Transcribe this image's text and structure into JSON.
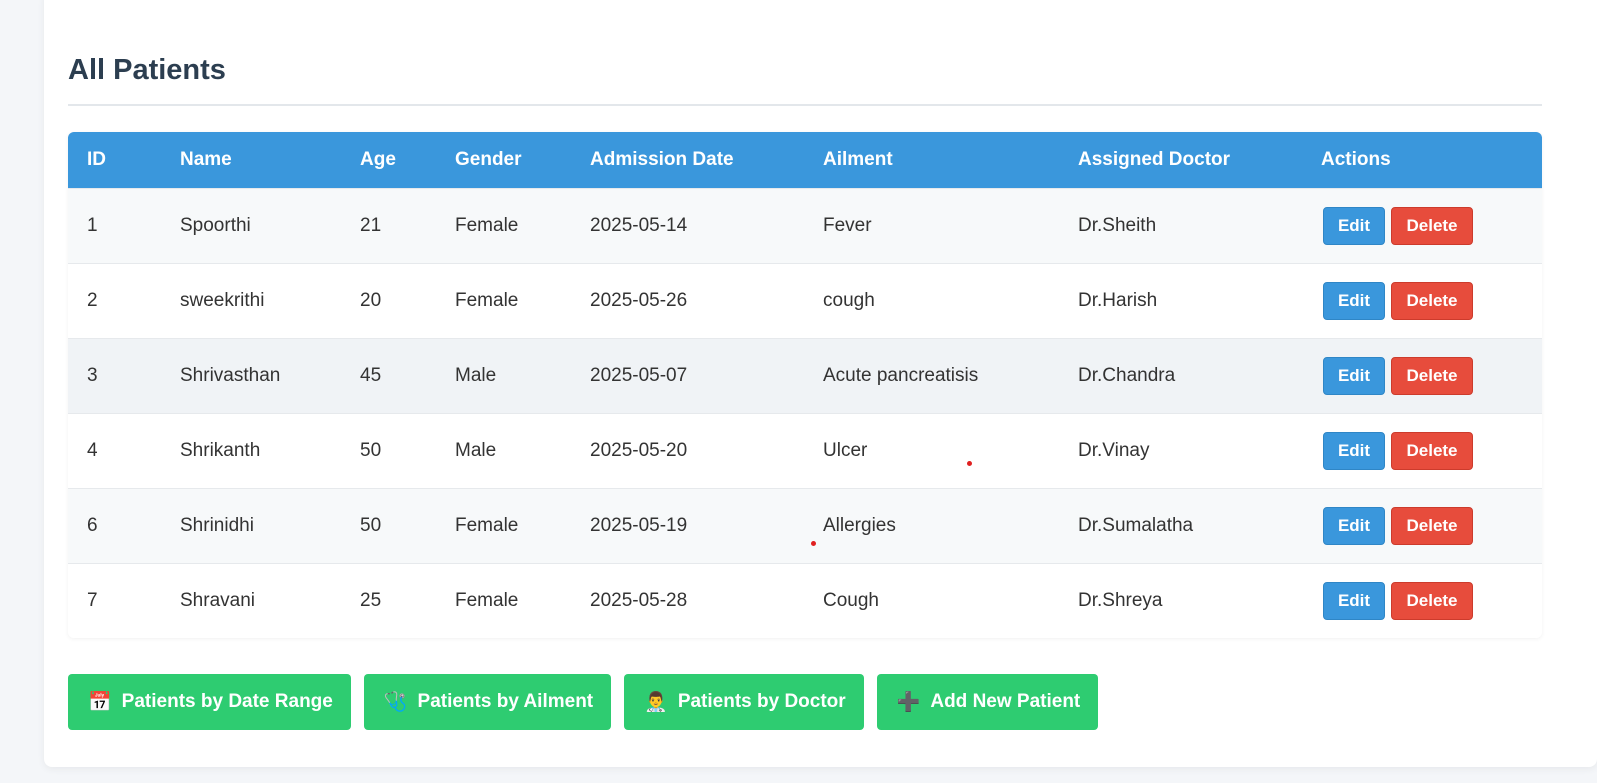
{
  "page": {
    "title": "All Patients"
  },
  "table": {
    "headers": [
      "ID",
      "Name",
      "Age",
      "Gender",
      "Admission Date",
      "Ailment",
      "Assigned Doctor",
      "Actions"
    ],
    "rows": [
      {
        "id": "1",
        "name": "Spoorthi",
        "age": "21",
        "gender": "Female",
        "date": "2025-05-14",
        "ailment": "Fever",
        "doctor": "Dr.Sheith"
      },
      {
        "id": "2",
        "name": "sweekrithi",
        "age": "20",
        "gender": "Female",
        "date": "2025-05-26",
        "ailment": "cough",
        "doctor": "Dr.Harish"
      },
      {
        "id": "3",
        "name": "Shrivasthan",
        "age": "45",
        "gender": "Male",
        "date": "2025-05-07",
        "ailment": "Acute pancreatisis",
        "doctor": "Dr.Chandra"
      },
      {
        "id": "4",
        "name": "Shrikanth",
        "age": "50",
        "gender": "Male",
        "date": "2025-05-20",
        "ailment": "Ulcer",
        "doctor": "Dr.Vinay"
      },
      {
        "id": "6",
        "name": "Shrinidhi",
        "age": "50",
        "gender": "Female",
        "date": "2025-05-19",
        "ailment": "Allergies",
        "doctor": "Dr.Sumalatha"
      },
      {
        "id": "7",
        "name": "Shravani",
        "age": "25",
        "gender": "Female",
        "date": "2025-05-28",
        "ailment": "Cough",
        "doctor": "Dr.Shreya"
      }
    ],
    "edit_label": "Edit",
    "delete_label": "Delete"
  },
  "actions": [
    {
      "label": "Patients by Date Range",
      "icon": "calendar-icon",
      "glyph": "📅"
    },
    {
      "label": "Patients by Ailment",
      "icon": "stethoscope-icon",
      "glyph": "🩺"
    },
    {
      "label": "Patients by Doctor",
      "icon": "doctor-icon",
      "glyph": "👨‍⚕️"
    },
    {
      "label": "Add New Patient",
      "icon": "plus-icon",
      "glyph": "➕"
    }
  ],
  "colors": {
    "header": "#3a97dc",
    "edit": "#3a97dc",
    "delete": "#e74c3c",
    "action": "#2ecc71",
    "title": "#2c3e50"
  }
}
